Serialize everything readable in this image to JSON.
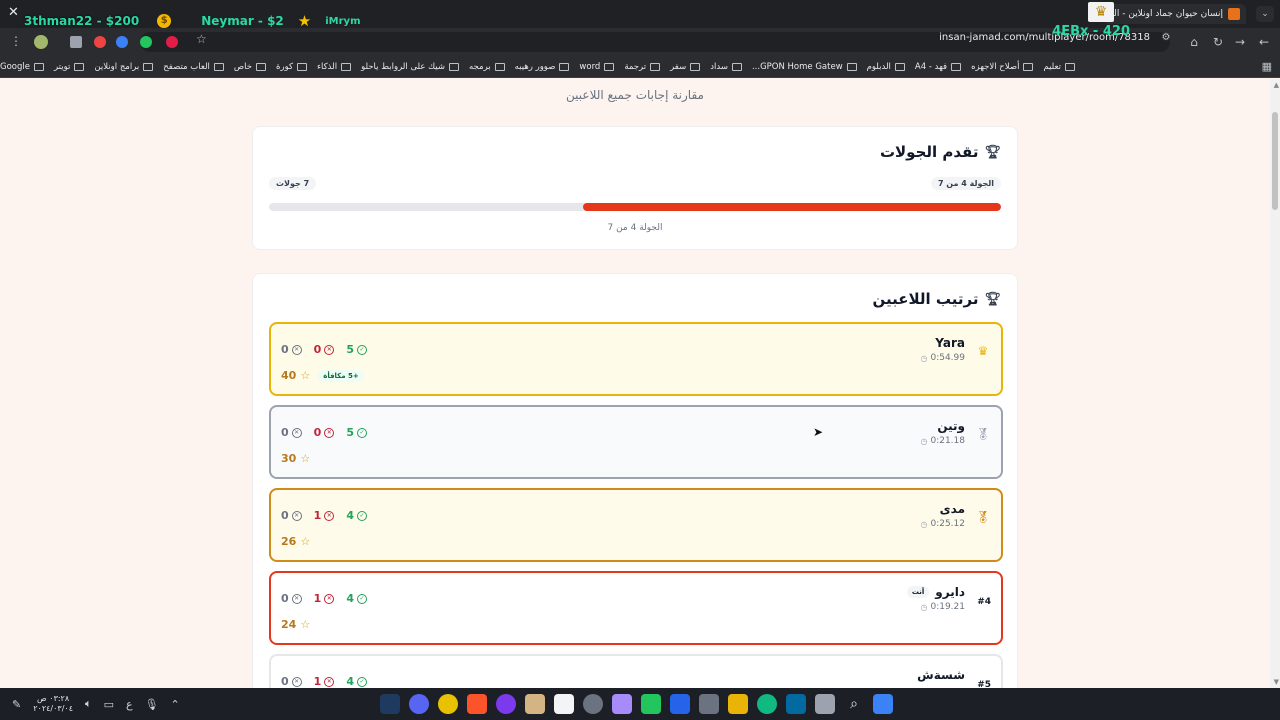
{
  "browser": {
    "tab_title": "إنسان حيوان جماد اونلاين - العب...",
    "url": "insan-jamad.com/multiplayer/room/78318",
    "bookmarks": [
      "Google",
      "تويتر",
      "برامج اونلاين",
      "العاب متصفح",
      "خاص",
      "كورة",
      "الذكاء",
      "شيك على الروابط ياحلو",
      "برمجه",
      "صوور رهيبه",
      "word",
      "ترجمة",
      "سفر",
      "سداد",
      "GPON Home Gatew...",
      "الدبلوم",
      "فهد - A4",
      "أصلاح الاجهزه",
      "تعليم"
    ]
  },
  "overlay": {
    "player1": "3thman22 - $200",
    "player2": "Neymar - $2",
    "player3": "iMrym",
    "top_right": "4EBx - 420"
  },
  "page": {
    "subtitle": "مقارنة إجابات جميع اللاعبين",
    "rounds": {
      "title": "تقدم الجولات",
      "current_label": "الجولة 4 من 7",
      "total_label": "7 جولات",
      "caption": "الجولة 4 من 7",
      "current": 4,
      "total": 7
    },
    "ranking": {
      "title": "ترتيب اللاعبين",
      "players": [
        {
          "name": "Yara",
          "time": "0:54.99",
          "correct": "5",
          "wrong": "0",
          "skipped": "0",
          "score": "40",
          "bonus": "+5 مكافأة"
        },
        {
          "name": "وتين",
          "time": "0:21.18",
          "correct": "5",
          "wrong": "0",
          "skipped": "0",
          "score": "30"
        },
        {
          "name": "مدى",
          "time": "0:25.12",
          "correct": "4",
          "wrong": "1",
          "skipped": "0",
          "score": "26"
        },
        {
          "name": "دايرو",
          "time": "0:19.21",
          "correct": "4",
          "wrong": "1",
          "skipped": "0",
          "score": "24",
          "rank": "#4",
          "you_badge": "أنت"
        },
        {
          "name": "شسةش",
          "correct": "4",
          "wrong": "1",
          "skipped": "0",
          "rank": "#5"
        }
      ]
    }
  },
  "taskbar": {
    "time": "٠٣:٢٨ ص",
    "date": "٢٠٢٤/٠٣/٠٤",
    "lang": "ع"
  },
  "colors": {
    "accent": "#e5381a",
    "gold": "#eab308",
    "silver": "#9ca3af",
    "bronze": "#d08c1a",
    "correct": "#22a35a",
    "wrong": "#c0263a"
  }
}
